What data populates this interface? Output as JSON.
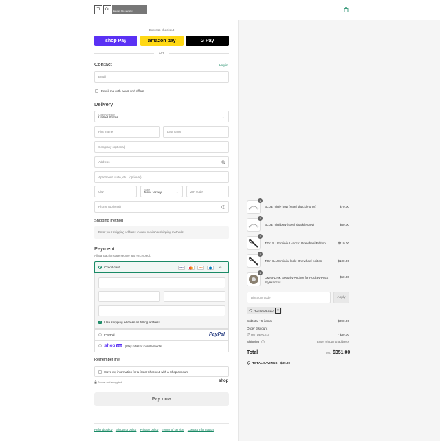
{
  "header": {
    "logo_box1": "Ti",
    "logo_box2": "Gr",
    "logo_slogan": "Elegant bike security"
  },
  "express": {
    "title": "Express checkout",
    "shop_pay_label": "shop Pay",
    "amazon_pay_label": "amazon pay",
    "gpay_label": "G Pay",
    "or_label": "OR"
  },
  "contact": {
    "heading": "Contact",
    "login_link": "Log in",
    "email_placeholder": "Email",
    "news_label": "Email me with news and offers"
  },
  "delivery": {
    "heading": "Delivery",
    "country_label": "Country/Region",
    "country_value": "United States",
    "first_name": "First name",
    "last_name": "Last name",
    "company": "Company (optional)",
    "address": "Address",
    "apartment": "Apartment, suite, etc. (optional)",
    "city": "City",
    "state_label": "State",
    "state_value": "New Jersey",
    "zip": "ZIP code",
    "phone": "Phone (optional)"
  },
  "shipping_method": {
    "heading": "Shipping method",
    "notice": "Enter your shipping address to view available shipping methods."
  },
  "payment": {
    "heading": "Payment",
    "subtitle": "All transactions are secure and encrypted.",
    "credit_card_label": "Credit card",
    "card_more": "+5",
    "billing_label": "Use shipping address as billing address",
    "paypal_label": "PayPal",
    "paypal_logo": "PayPal",
    "shoppay_logo": "shop",
    "shoppay_badge": "Pay",
    "shoppay_text": "| Pay in full or in installments"
  },
  "remember": {
    "heading": "Remember me",
    "save_label": "Save my information for a faster checkout with a Shop account",
    "secure_label": "Secure and encrypted",
    "shop_logo": "shop"
  },
  "pay_now_label": "Pay now",
  "footer": {
    "links": [
      "Refund policy",
      "Shipping policy",
      "Privacy policy",
      "Terms of service",
      "Contact information"
    ]
  },
  "order": {
    "items": [
      {
        "qty": "1",
        "name": "BLUE mini+ bow (steel shackle only)",
        "price": "$70.00"
      },
      {
        "qty": "1",
        "name": "BLUE mini bow (steel shackle only)",
        "price": "$60.00"
      },
      {
        "qty": "1",
        "name": "TiGr BLUE mini+ U-Lock: Onewheel Edition",
        "price": "$110.00"
      },
      {
        "qty": "1",
        "name": "TiGr BLUE mini u-lock: Onewheel edition",
        "price": "$100.00"
      },
      {
        "qty": "1",
        "name": "OMNI-LINK Security Anchor for Hockey-Puck Style Locks",
        "price": "$50.00"
      }
    ],
    "discount_placeholder": "Discount code",
    "apply_label": "Apply",
    "applied_code": "HOTDEALS10",
    "subtotal_label": "Subtotal • 5 items",
    "subtotal_value": "$390.00",
    "order_discount_label": "Order discount",
    "discount_code_label": "HOTDEALS10",
    "discount_value": "- $39.00",
    "shipping_label": "Shipping",
    "shipping_value": "Enter shipping address",
    "total_label": "Total",
    "currency": "USD",
    "total_value": "$351.00",
    "savings_label": "TOTAL SAVINGS",
    "savings_value": "$39.00"
  },
  "colors": {
    "accent": "#1a8a66",
    "shop_pay": "#5a31f4",
    "amazon": "#ffd814",
    "gpay": "#000000"
  }
}
